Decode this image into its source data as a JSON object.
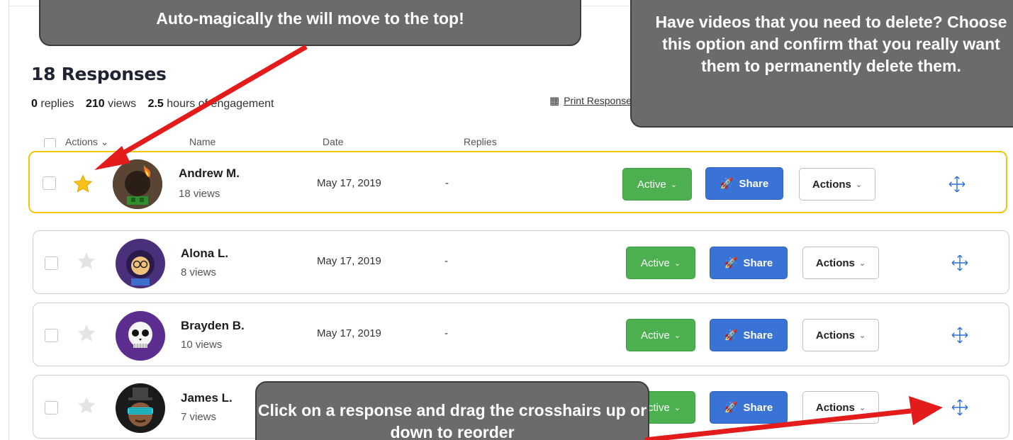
{
  "title": "18 Responses",
  "stats": {
    "replies_count": "0",
    "replies_label": "replies",
    "views_count": "210",
    "views_label": "views",
    "engagement_count": "2.5",
    "engagement_label": "hours of engagement"
  },
  "print_link": "Print Responses",
  "table_header": {
    "actions": "Actions ⌄",
    "name": "Name",
    "date": "Date",
    "replies": "Replies"
  },
  "rows": [
    {
      "name": "Andrew M.",
      "views": "18 views",
      "date": "May 17, 2019",
      "replies": "-",
      "status": "Active",
      "share": "Share",
      "actions": "Actions",
      "starred": true
    },
    {
      "name": "Alona L.",
      "views": "8 views",
      "date": "May 17, 2019",
      "replies": "-",
      "status": "Active",
      "share": "Share",
      "actions": "Actions",
      "starred": false
    },
    {
      "name": "Brayden B.",
      "views": "10 views",
      "date": "May 17, 2019",
      "replies": "-",
      "status": "Active",
      "share": "Share",
      "actions": "Actions",
      "starred": false
    },
    {
      "name": "James L.",
      "views": "7 views",
      "date": "",
      "replies": "",
      "status": "Active",
      "share": "Share",
      "actions": "Actions",
      "starred": false
    }
  ],
  "callouts": {
    "top": "Auto-magically the will move to the top!",
    "right": "Have videos that you need to delete? Choose this option and confirm that you really want them to permanently delete them.",
    "bottom": "Click on a response and drag the crosshairs up or down to reorder"
  },
  "colors": {
    "active_green": "#4caf50",
    "share_blue": "#3a73d6",
    "featured_border": "#f1c40f",
    "callout_gray": "#6b6b6b",
    "arrow_red": "#e31b1b",
    "move_blue": "#2f6fd6"
  },
  "icons": {
    "star": "star-icon",
    "move": "move-crosshair-icon",
    "share": "rocket-icon",
    "print": "qr-code-icon"
  }
}
